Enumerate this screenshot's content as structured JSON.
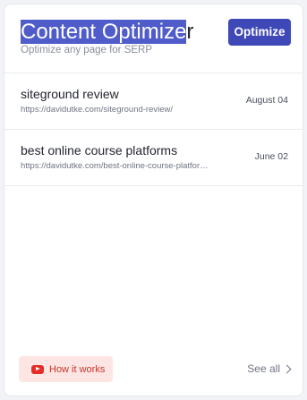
{
  "header": {
    "title_selected": "Content Optimize",
    "title_rest": "r",
    "subtitle": "Optimize any page for SERP",
    "optimize_label": "Optimize"
  },
  "items": [
    {
      "keyword": "siteground review",
      "url": "https://davidutke.com/siteground-review/",
      "date": "August 04"
    },
    {
      "keyword": "best online course platforms",
      "url": "https://davidutke.com/best-online-course-platforms/",
      "date": "June 02"
    }
  ],
  "footer": {
    "how_label": "How it works",
    "how_icon": "youtube-icon",
    "see_all_label": "See all",
    "see_all_icon": "chevron-right-icon"
  },
  "colors": {
    "primary_button": "#3e48b7",
    "selection": "#4f5cc9",
    "how_bg": "#fde5e4",
    "youtube_red": "#e52d27"
  }
}
